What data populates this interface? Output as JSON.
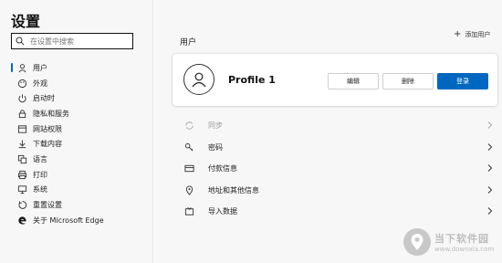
{
  "sidebar": {
    "title": "设置",
    "search_placeholder": "在设置中搜索",
    "items": [
      {
        "label": "用户",
        "icon": "person-icon",
        "active": true
      },
      {
        "label": "外观",
        "icon": "palette-icon"
      },
      {
        "label": "启动时",
        "icon": "power-icon"
      },
      {
        "label": "隐私和服务",
        "icon": "lock-icon"
      },
      {
        "label": "网站权限",
        "icon": "site-permissions-icon"
      },
      {
        "label": "下载内容",
        "icon": "download-icon"
      },
      {
        "label": "语言",
        "icon": "language-icon"
      },
      {
        "label": "打印",
        "icon": "printer-icon"
      },
      {
        "label": "系统",
        "icon": "computer-icon"
      },
      {
        "label": "重置设置",
        "icon": "reset-icon"
      },
      {
        "label": "关于 Microsoft Edge",
        "icon": "edge-logo-icon"
      }
    ]
  },
  "main": {
    "section_title": "用户",
    "add_user_label": "添加用户",
    "profile": {
      "name": "Profile 1",
      "edit_label": "编辑",
      "delete_label": "删除",
      "signin_label": "登录"
    },
    "rows": [
      {
        "label": "同步",
        "icon": "sync-icon",
        "disabled": true
      },
      {
        "label": "密码",
        "icon": "key-icon"
      },
      {
        "label": "付款信息",
        "icon": "credit-card-icon"
      },
      {
        "label": "地址和其他信息",
        "icon": "location-pin-icon"
      },
      {
        "label": "导入数据",
        "icon": "import-icon"
      }
    ]
  },
  "watermark": {
    "cn": "当下软件园",
    "en": "www.downxia.com"
  },
  "colors": {
    "accent": "#0067c0",
    "background": "#f7f7f7",
    "card": "#ffffff"
  }
}
